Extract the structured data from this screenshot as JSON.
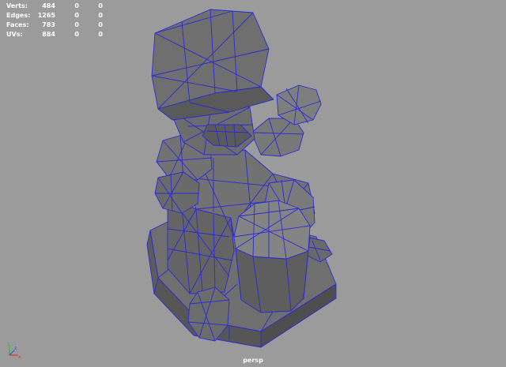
{
  "hud": {
    "rows": [
      {
        "label": "Verts:",
        "v1": "484",
        "v2": "0",
        "v3": "0"
      },
      {
        "label": "Edges:",
        "v1": "1265",
        "v2": "0",
        "v3": "0"
      },
      {
        "label": "Faces:",
        "v1": "783",
        "v2": "0",
        "v3": "0"
      },
      {
        "label": "UVs:",
        "v1": "884",
        "v2": "0",
        "v3": "0"
      }
    ]
  },
  "camera": {
    "label": "persp"
  },
  "axis": {
    "x": "x",
    "y": "y",
    "z": "z"
  },
  "colors": {
    "wire": "#2a2ad8",
    "face": "#6e6e6e",
    "face_light": "#828282",
    "face_dark": "#555555",
    "bg": "#9b9b9b"
  }
}
